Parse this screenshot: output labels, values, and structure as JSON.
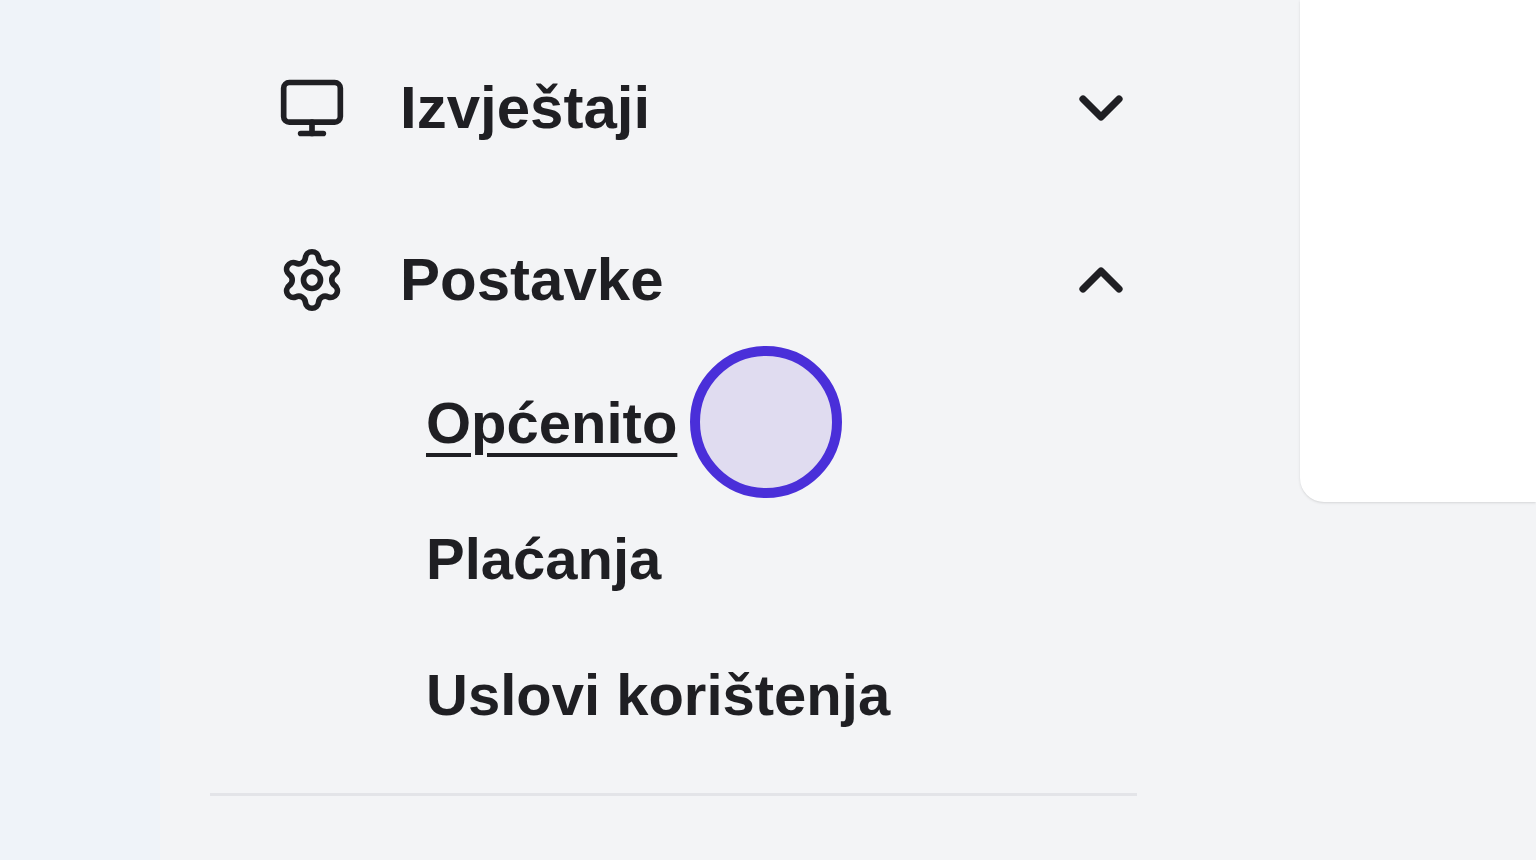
{
  "sidebar": {
    "items": [
      {
        "label": "Izvještaji",
        "expanded": false
      },
      {
        "label": "Postavke",
        "expanded": true,
        "children": [
          {
            "label": "Općenito",
            "selected": true
          },
          {
            "label": "Plaćanja",
            "selected": false
          },
          {
            "label": "Uslovi korištenja",
            "selected": false
          }
        ]
      }
    ]
  }
}
